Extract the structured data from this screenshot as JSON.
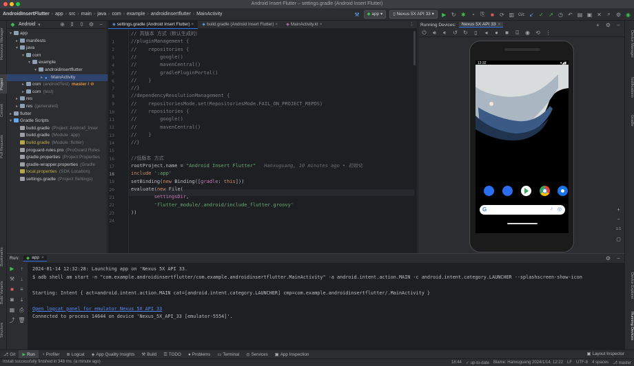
{
  "window": {
    "title": "Android Insert Flutter – settings.gradle (Android Insert Flutter)"
  },
  "breadcrumb": [
    "AndroidInsertFlutter",
    "app",
    "src",
    "main",
    "java",
    "com",
    "example",
    "androidinsertflutter",
    "MainActivity"
  ],
  "toolbar": {
    "run_config": "app",
    "device": "Nexus 5X API 33",
    "git_label": "Git:"
  },
  "project": {
    "view_label": "Android",
    "tree": [
      {
        "label": "app",
        "note": "",
        "level": 0,
        "kind": "folder",
        "open": true
      },
      {
        "label": "manifests",
        "note": "",
        "level": 1,
        "kind": "folder",
        "open": false
      },
      {
        "label": "java",
        "note": "",
        "level": 1,
        "kind": "folder",
        "open": true
      },
      {
        "label": "com",
        "note": "",
        "level": 2,
        "kind": "pkg",
        "open": true
      },
      {
        "label": "example",
        "note": "",
        "level": 3,
        "kind": "pkg",
        "open": true
      },
      {
        "label": "androidinsertflutter",
        "note": "",
        "level": 4,
        "kind": "pkg",
        "open": true
      },
      {
        "label": "MainActivity",
        "note": "",
        "level": 5,
        "kind": "class",
        "open": false,
        "selected": true
      },
      {
        "label": "com",
        "note": "(androidTest)",
        "branch": "master / ⊘",
        "level": 2,
        "kind": "pkg",
        "open": false
      },
      {
        "label": "com",
        "note": "(test)",
        "level": 2,
        "kind": "pkg",
        "open": false
      },
      {
        "label": "res",
        "note": "",
        "level": 1,
        "kind": "folder",
        "open": false
      },
      {
        "label": "res",
        "note": "(generated)",
        "level": 1,
        "kind": "folder",
        "open": false
      },
      {
        "label": "flutter",
        "note": "",
        "level": 0,
        "kind": "folder",
        "open": false
      },
      {
        "label": "Gradle Scripts",
        "note": "",
        "level": 0,
        "kind": "gradle",
        "open": true
      },
      {
        "label": "build.gradle",
        "note": "(Project: Android_Inser",
        "level": 1,
        "kind": "file"
      },
      {
        "label": "build.gradle",
        "note": "(Module :app)",
        "level": 1,
        "kind": "file"
      },
      {
        "label": "build.gradle",
        "note": "(Module :flutter)",
        "level": 1,
        "kind": "file",
        "warn": true
      },
      {
        "label": "proguard-rules.pro",
        "note": "(ProGuard Rules",
        "level": 1,
        "kind": "file"
      },
      {
        "label": "gradle.properties",
        "note": "(Project Properties",
        "level": 1,
        "kind": "file"
      },
      {
        "label": "gradle-wrapper.properties",
        "note": "(Gradle",
        "level": 1,
        "kind": "file"
      },
      {
        "label": "local.properties",
        "note": "(SDK Location)",
        "level": 1,
        "kind": "file",
        "warn": true
      },
      {
        "label": "settings.gradle",
        "note": "(Project Settings)",
        "level": 1,
        "kind": "file"
      }
    ]
  },
  "left_strip": {
    "project": "Project",
    "commit": "Commit",
    "resource_manager": "Resource Manager",
    "pull_requests": "Pull Requests",
    "bookmarks": "Bookmarks",
    "build_variants": "Build Variants",
    "structure": "Structure"
  },
  "right_strip": {
    "device_manager": "Device Manager",
    "notifications": "Notifications",
    "gradle": "Gradle",
    "device_explorer": "Device Explorer",
    "running_devices": "Running Devices"
  },
  "editor": {
    "tabs": [
      "settings.gradle (Android Insert Flutter)",
      "build.gradle (Android Insert Flutter)",
      "MainActivity.kt"
    ],
    "line_numbers": [
      "1",
      "2",
      "3",
      "4",
      "5",
      "6",
      "7",
      "8",
      "9",
      "10",
      "11",
      "12",
      "13",
      "14",
      "15",
      "16",
      "17",
      "18",
      "19",
      "20",
      "21",
      "22",
      "23",
      "24"
    ],
    "lines": [
      "// 高版本 方式（默认生成的）",
      "//pluginManagement {",
      "//    repositories {",
      "//        google()",
      "//        mavenCentral()",
      "//        gradlePluginPortal()",
      "//    }",
      "//}",
      "//dependencyResolutionManagement {",
      "//    repositoriesMode.set(RepositoriesMode.FAIL_ON_PROJECT_REPOS)",
      "//    repositories {",
      "//        google()",
      "//        mavenCentral()",
      "//    }",
      "//}",
      "",
      "//低版本 方式",
      "rootProject.name = \"Android Insert Flutter\"",
      "include ':app'",
      "setBinding(new Binding([gradle: this]))",
      "evaluate(new File(",
      "        settingsDir,",
      "        'flutter_module/.android/include_flutter.groovy'",
      "))"
    ],
    "blame_hint": "Hanxuguang, 10 minutes ago • 初始化"
  },
  "running_devices": {
    "title": "Running Devices:",
    "device_tab": "Nexus 5X API 33",
    "status_time": "12:32"
  },
  "run_panel": {
    "label": "Run:",
    "config": "app",
    "lines": [
      "2024-01-14 12:32:28: Launching app on 'Nexus 5X API 33.",
      "$ adb shell am start -n \"com.example.androidinsertflutter/com.example.androidinsertflutter.MainActivity\" -a android.intent.action.MAIN -c android.intent.category.LAUNCHER --splashscreen-show-icon",
      "",
      "Starting: Intent { act=android.intent.action.MAIN cat=[android.intent.category.LAUNCHER] cmp=com.example.androidinsertflutter/.MainActivity }",
      "",
      "Open logcat panel for emulator Nexus 5X API 33",
      "Connected to process 14644 on device 'Nexus_5X_API_33 [emulator-5554]'."
    ]
  },
  "bottom_tabs": [
    "Git",
    "Run",
    "Profiler",
    "Logcat",
    "App Quality Insights",
    "Build",
    "TODO",
    "Problems",
    "Terminal",
    "Services",
    "App Inspection"
  ],
  "bottom_right": "Layout Inspector",
  "status": {
    "message": "Install successfully finished in 348 ms. (a minute ago)",
    "position": "18:44",
    "vcs": "up-to-date",
    "blame": "Blame: Hanxuguang 2024/1/14, 12:22",
    "line_sep": "LF",
    "encoding": "UTF-8",
    "indent": "4 spaces",
    "branch": "master"
  },
  "zoom_controls": {
    "plus": "+",
    "minus": "−",
    "one_to_one": "1:1"
  }
}
